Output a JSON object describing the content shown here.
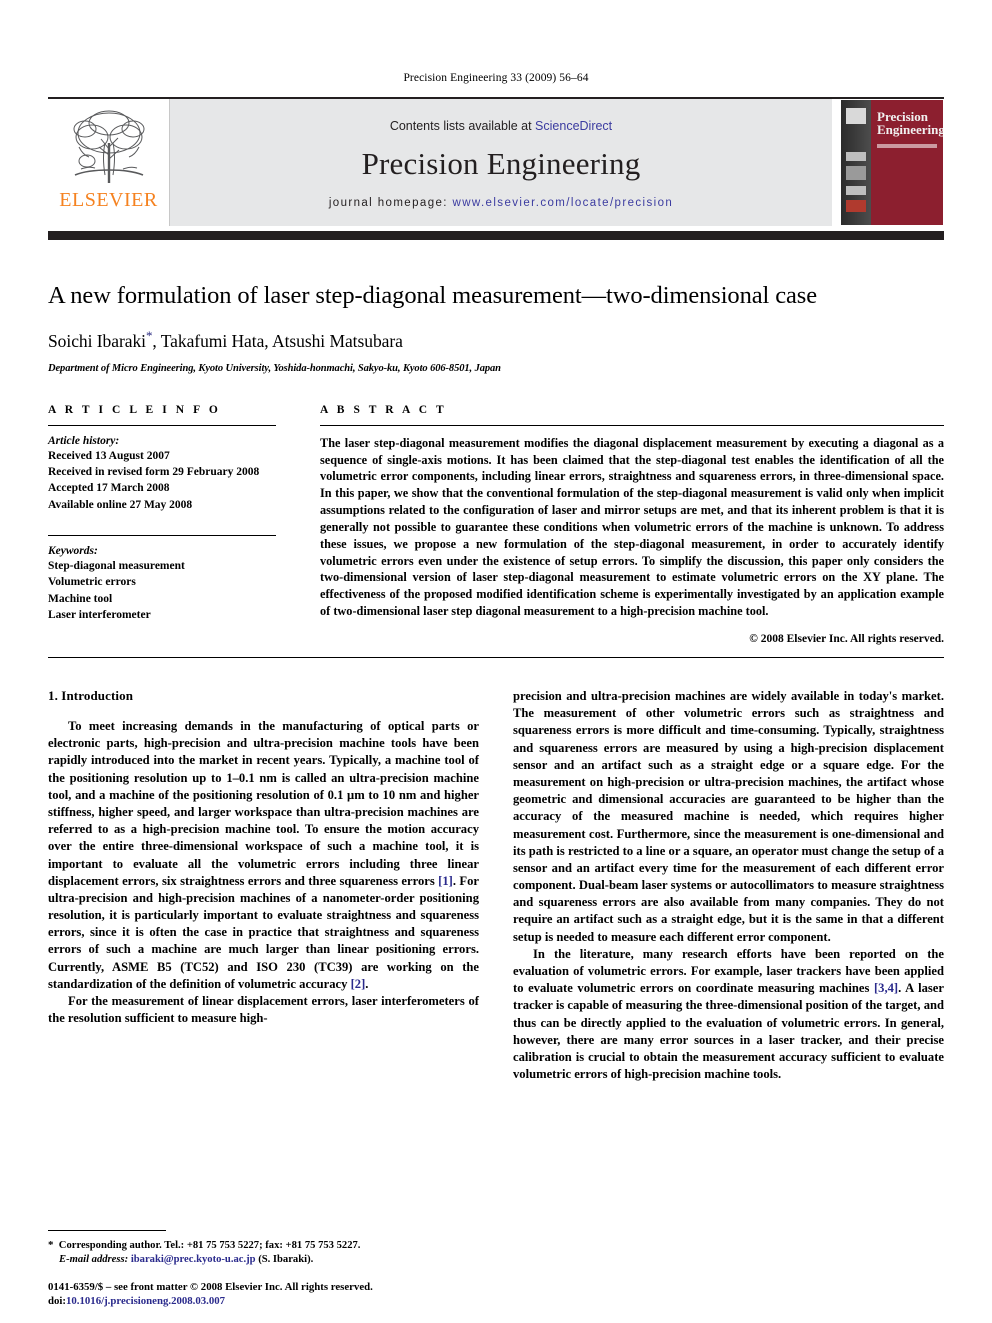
{
  "running_head": "Precision Engineering 33 (2009) 56–64",
  "masthead": {
    "publisher_name": "ELSEVIER",
    "contents_prefix": "Contents lists available at ",
    "contents_link": "ScienceDirect",
    "journal_title": "Precision Engineering",
    "homepage_prefix": "journal homepage: ",
    "homepage_url": "www.elsevier.com/locate/precision",
    "cover_title_line1": "Precision",
    "cover_title_line2": "Engineering",
    "accent_orange": "#f58220",
    "link_blue": "#3b3ba0",
    "cover_red": "#8c1f2f",
    "band_gray": "#e6e7e8"
  },
  "article": {
    "title": "A new formulation of laser step-diagonal measurement—two-dimensional case",
    "authors": "Soichi Ibaraki, Takafumi Hata, Atsushi Matsubara",
    "author_first": "Soichi Ibaraki",
    "author_rest": ", Takafumi Hata, Atsushi Matsubara",
    "corresponding_marker": "*",
    "affiliation": "Department of Micro Engineering, Kyoto University, Yoshida-honmachi, Sakyo-ku, Kyoto 606-8501, Japan"
  },
  "info": {
    "heading": "A R T I C L E   I N F O",
    "history_label": "Article history:",
    "history": [
      "Received 13 August 2007",
      "Received in revised form 29 February 2008",
      "Accepted 17 March 2008",
      "Available online 27 May 2008"
    ],
    "keywords_label": "Keywords:",
    "keywords": [
      "Step-diagonal measurement",
      "Volumetric errors",
      "Machine tool",
      "Laser interferometer"
    ]
  },
  "abstract": {
    "heading": "A B S T R A C T",
    "text": "The laser step-diagonal measurement modifies the diagonal displacement measurement by executing a diagonal as a sequence of single-axis motions. It has been claimed that the step-diagonal test enables the identification of all the volumetric error components, including linear errors, straightness and squareness errors, in three-dimensional space. In this paper, we show that the conventional formulation of the step-diagonal measurement is valid only when implicit assumptions related to the configuration of laser and mirror setups are met, and that its inherent problem is that it is generally not possible to guarantee these conditions when volumetric errors of the machine is unknown. To address these issues, we propose a new formulation of the step-diagonal measurement, in order to accurately identify volumetric errors even under the existence of setup errors. To simplify the discussion, this paper only considers the two-dimensional version of laser step-diagonal measurement to estimate volumetric errors on the XY plane. The effectiveness of the proposed modified identification scheme is experimentally investigated by an application example of two-dimensional laser step diagonal measurement to a high-precision machine tool.",
    "copyright": "© 2008 Elsevier Inc. All rights reserved."
  },
  "body": {
    "section_heading": "1. Introduction",
    "left_para_1": "To meet increasing demands in the manufacturing of optical parts or electronic parts, high-precision and ultra-precision machine tools have been rapidly introduced into the market in recent years. Typically, a machine tool of the positioning resolution up to 1–0.1 nm is called an ultra-precision machine tool, and a machine of the positioning resolution of 0.1 μm to 10 nm and higher stiffness, higher speed, and larger workspace than ultra-precision machines are referred to as a high-precision machine tool. To ensure the motion accuracy over the entire three-dimensional workspace of such a machine tool, it is important to evaluate all the volumetric errors including three linear displacement errors, six straightness errors and three squareness errors ",
    "left_ref_1": "[1]",
    "left_para_1b": ". For ultra-precision and high-precision machines of a nanometer-order positioning resolution, it is particularly important to evaluate straightness and squareness errors, since it is often the case in practice that straightness and squareness errors of such a machine are much larger than linear positioning errors. Currently, ASME B5 (TC52) and ISO 230 (TC39) are working on the standardization of the definition of volumetric accuracy ",
    "left_ref_2": "[2]",
    "left_para_1c": ".",
    "left_para_2": "For the measurement of linear displacement errors, laser interferometers of the resolution sufficient to measure high-",
    "right_para_1": "precision and ultra-precision machines are widely available in today's market. The measurement of other volumetric errors such as straightness and squareness errors is more difficult and time-consuming. Typically, straightness and squareness errors are measured by using a high-precision displacement sensor and an artifact such as a straight edge or a square edge. For the measurement on high-precision or ultra-precision machines, the artifact whose geometric and dimensional accuracies are guaranteed to be higher than the accuracy of the measured machine is needed, which requires higher measurement cost. Furthermore, since the measurement is one-dimensional and its path is restricted to a line or a square, an operator must change the setup of a sensor and an artifact every time for the measurement of each different error component. Dual-beam laser systems or autocollimators to measure straightness and squareness errors are also available from many companies. They do not require an artifact such as a straight edge, but it is the same in that a different setup is needed to measure each different error component.",
    "right_para_2a": "In the literature, many research efforts have been reported on the evaluation of volumetric errors. For example, laser trackers have been applied to evaluate volumetric errors on coordinate measuring machines ",
    "right_ref_1": "[3,4]",
    "right_para_2b": ". A laser tracker is capable of measuring the three-dimensional position of the target, and thus can be directly applied to the evaluation of volumetric errors. In general, however, there are many error sources in a laser tracker, and their precise calibration is crucial to obtain the measurement accuracy sufficient to evaluate volumetric errors of high-precision machine tools."
  },
  "footnotes": {
    "corresponding_marker": "*",
    "corresponding_text": "Corresponding author. Tel.: +81 75 753 5227; fax: +81 75 753 5227.",
    "email_label": "E-mail address:",
    "email": "ibaraki@prec.kyoto-u.ac.jp",
    "email_suffix": "(S. Ibaraki)."
  },
  "imprint": {
    "line1": "0141-6359/$ – see front matter © 2008 Elsevier Inc. All rights reserved.",
    "doi_label": "doi:",
    "doi": "10.1016/j.precisioneng.2008.03.007"
  }
}
